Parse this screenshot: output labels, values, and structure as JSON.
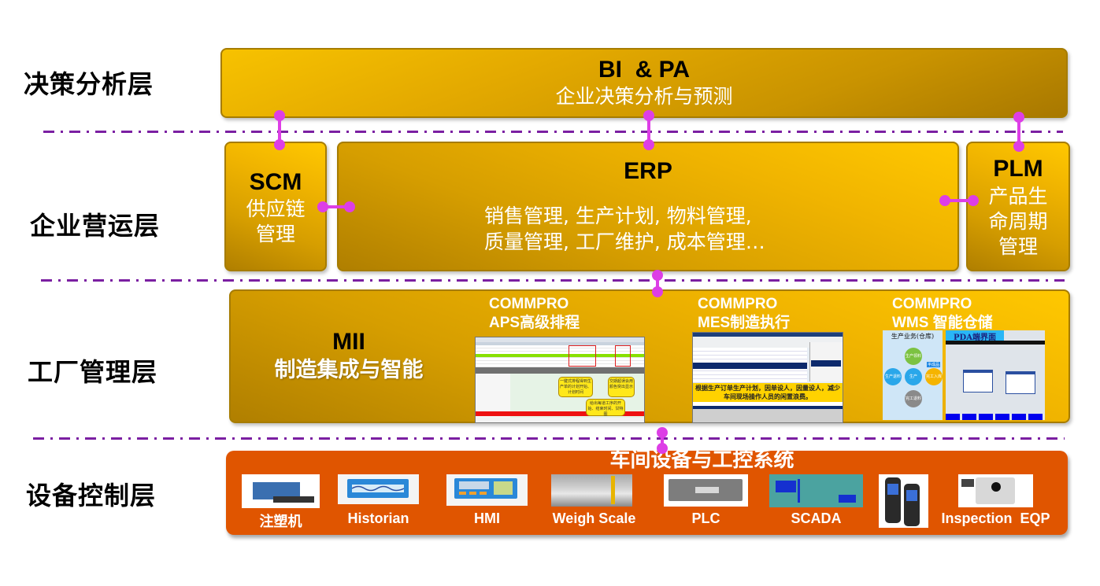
{
  "layers": [
    {
      "label": "决策分析层"
    },
    {
      "label": "企业营运层"
    },
    {
      "label": "工厂管理层"
    },
    {
      "label": "设备控制层"
    }
  ],
  "bi": {
    "title": "BI  & PA",
    "subtitle": "企业决策分析与预测"
  },
  "scm": {
    "title": "SCM",
    "line1": "供应链",
    "line2": "管理"
  },
  "erp": {
    "title": "ERP",
    "line1": "销售管理, 生产计划, 物料管理,",
    "line2": "质量管理, 工厂维护, 成本管理…"
  },
  "plm": {
    "title": "PLM",
    "line1": "产品生",
    "line2": "命周期",
    "line3": "管理"
  },
  "mii": {
    "title": "MII",
    "subtitle": "制造集成与智能",
    "modules": [
      {
        "brand": "COMMPRO",
        "name": "APS高级排程",
        "callouts": [
          "一键式排程得到生产单的计划开始、计划时间",
          "交期超误会用颜色突出显示",
          "给出每道工序的开始、结束时间、甘特图"
        ]
      },
      {
        "brand": "COMMPRO",
        "name": "MES制造执行",
        "banner": "根据生产订单生产计划，因单设人，因量设人，减少车间现场操作人员的闲置浪费。"
      },
      {
        "brand": "COMMPRO",
        "name": "WMS 智能仓储",
        "panel_title": "生产业务(仓库)",
        "pda_title": "PDA端界面",
        "nodes": [
          "生产退料",
          "生产",
          "生产领料",
          "完工入库",
          "完工退料"
        ],
        "tag": "半成品"
      }
    ]
  },
  "equipment": {
    "title": "车间设备与工控系统",
    "items": [
      {
        "label": "注塑机",
        "icon": "injection-molding-machine"
      },
      {
        "label": "Historian",
        "icon": "historian-monitor"
      },
      {
        "label": "HMI",
        "icon": "hmi-panel"
      },
      {
        "label": "Weigh Scale",
        "icon": "weigh-scale"
      },
      {
        "label": "PLC",
        "icon": "plc-controller"
      },
      {
        "label": "SCADA",
        "icon": "scada-screen"
      },
      {
        "label": "",
        "icon": "handheld-scanner"
      },
      {
        "label": "Inspection  EQP",
        "icon": "inspection-machine"
      }
    ]
  },
  "colors": {
    "gold": "#e3a900",
    "orange": "#e05500",
    "connector": "#dd3ee6",
    "divider": "#7b1fa2"
  }
}
